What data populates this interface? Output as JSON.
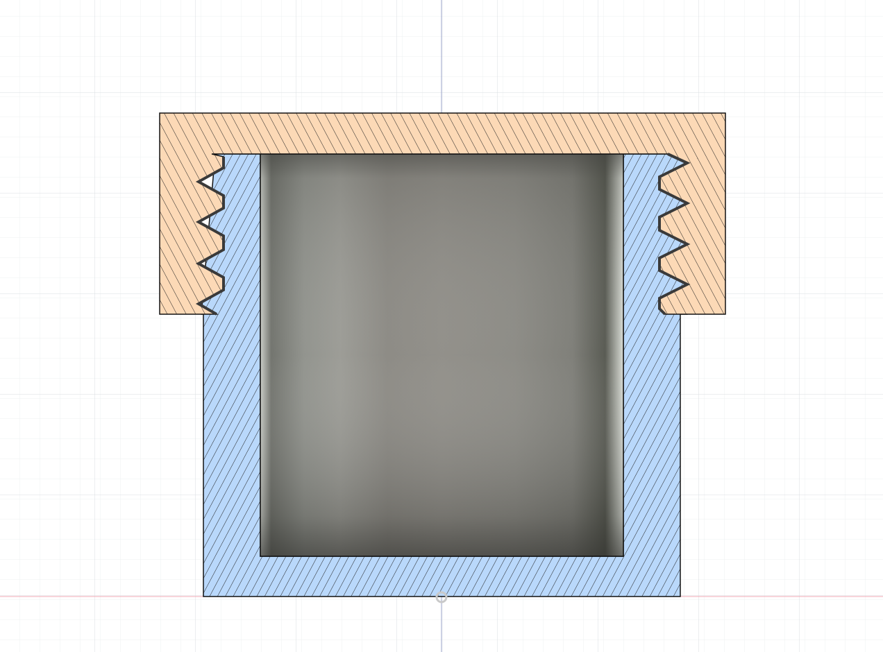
{
  "viewport": {
    "background": "#ffffff",
    "grid_minor_color": "#eef0f2",
    "grid_major_color": "#d9dde2",
    "axis_vertical_color": "#9aa3c8",
    "axis_horizontal_color": "#f2a8b4"
  },
  "section_view": {
    "cap_color": "#fcd9b6",
    "body_color": "#b9d8fb",
    "hatch_color": "#1f1f1f",
    "outline_color": "#111111",
    "cavity_color": "#8e8c86",
    "thread_color": "#3a3a3a"
  },
  "icons": [
    "origin-icon"
  ]
}
